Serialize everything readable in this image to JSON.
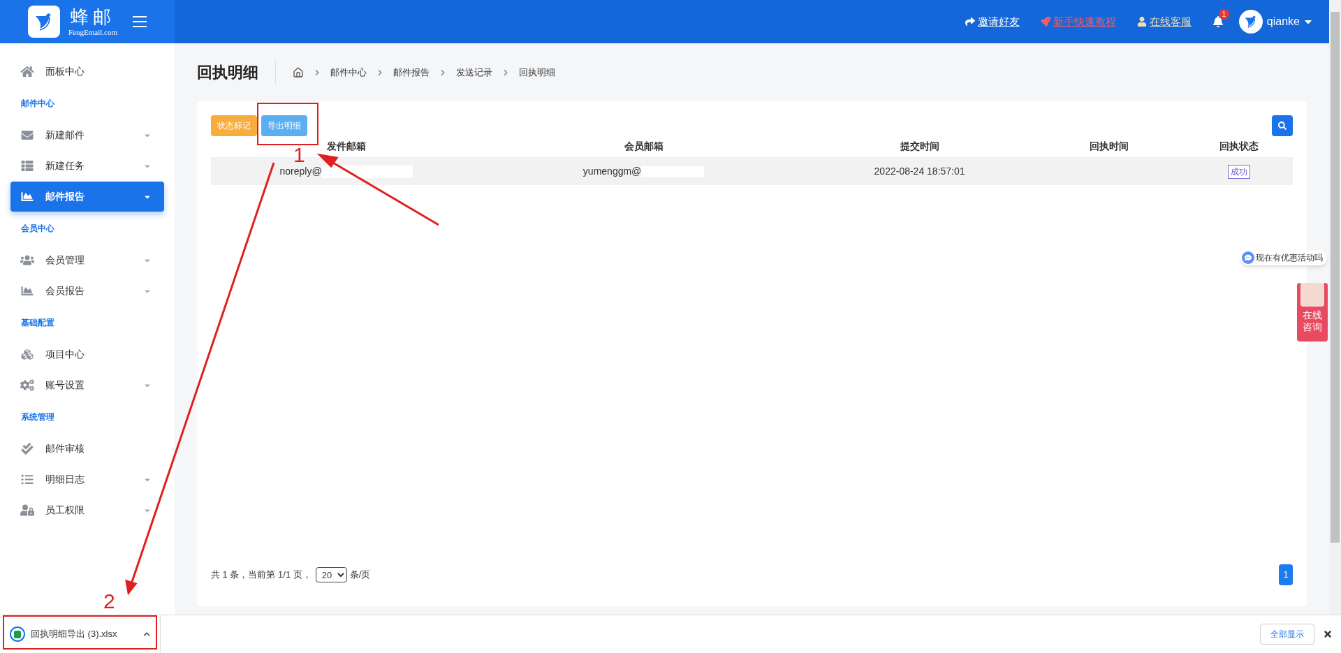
{
  "header": {
    "logo": {
      "name": "蜂邮",
      "domain": "FengEmail.com"
    },
    "links": [
      {
        "kind": "invite",
        "label": "邀请好友",
        "color": "#ffffff"
      },
      {
        "kind": "tutorial",
        "label": "新手快速教程",
        "color": "#ff5a5f"
      },
      {
        "kind": "service",
        "label": "在线客服",
        "color": "#f5deb3"
      }
    ],
    "notifications": {
      "count": "1"
    },
    "user": {
      "name": "qianke"
    }
  },
  "sidebar": {
    "items": [
      {
        "kind": "item",
        "label": "面板中心",
        "selected": false,
        "expandable": false
      },
      {
        "kind": "section",
        "label": "邮件中心"
      },
      {
        "kind": "item",
        "label": "新建邮件",
        "selected": false,
        "expandable": true
      },
      {
        "kind": "item",
        "label": "新建任务",
        "selected": false,
        "expandable": true
      },
      {
        "kind": "item",
        "label": "邮件报告",
        "selected": true,
        "expandable": true
      },
      {
        "kind": "section",
        "label": "会员中心"
      },
      {
        "kind": "item",
        "label": "会员管理",
        "selected": false,
        "expandable": true
      },
      {
        "kind": "item",
        "label": "会员报告",
        "selected": false,
        "expandable": true
      },
      {
        "kind": "section",
        "label": "基础配置"
      },
      {
        "kind": "item",
        "label": "项目中心",
        "selected": false,
        "expandable": false
      },
      {
        "kind": "item",
        "label": "账号设置",
        "selected": false,
        "expandable": true
      },
      {
        "kind": "section",
        "label": "系统管理"
      },
      {
        "kind": "item",
        "label": "邮件审核",
        "selected": false,
        "expandable": false
      },
      {
        "kind": "item",
        "label": "明细日志",
        "selected": false,
        "expandable": true
      },
      {
        "kind": "item",
        "label": "员工权限",
        "selected": false,
        "expandable": true
      }
    ]
  },
  "page": {
    "title": "回执明细",
    "breadcrumb": [
      "邮件中心",
      "邮件报告",
      "发送记录",
      "回执明细"
    ]
  },
  "toolbar": {
    "buttons": [
      {
        "kind": "mark",
        "label": "状态标记"
      },
      {
        "kind": "export",
        "label": "导出明细"
      }
    ]
  },
  "table": {
    "columns": [
      "发件邮箱",
      "会员邮箱",
      "提交时间",
      "回执时间",
      "回执状态"
    ],
    "rows": [
      {
        "sender": "noreply@",
        "member": "yumenggm@",
        "submitted": "2022-08-24 18:57:01",
        "received": "",
        "status": "成功"
      }
    ]
  },
  "pagination": {
    "summary": "共 1 条，当前第 1/1 页，",
    "page_size": "20",
    "unit": "条/页",
    "pages": [
      {
        "label": "1",
        "selected": true
      }
    ]
  },
  "chat_widget": {
    "bubble": "现在有优惠活动吗",
    "consult": "在线咨询"
  },
  "download_bar": {
    "file": "回执明细导出 (3).xlsx",
    "show_all": "全部显示"
  },
  "annotations": [
    {
      "label": "1"
    },
    {
      "label": "2"
    }
  ]
}
